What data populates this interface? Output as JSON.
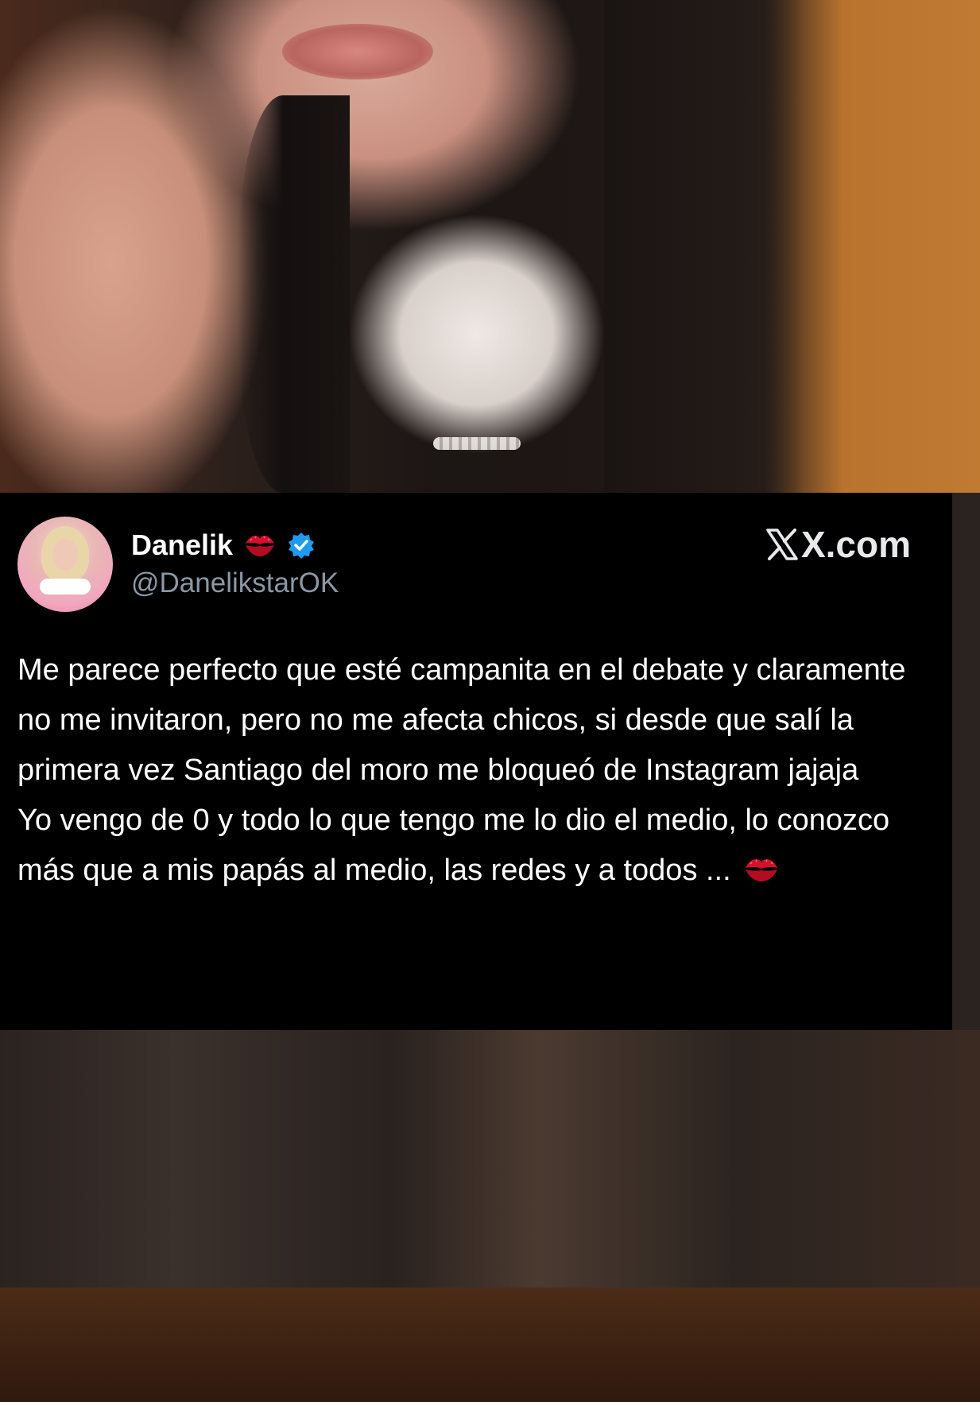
{
  "tweet": {
    "display_name": "Danelik",
    "handle": "@DanelikstarOK",
    "verified": true,
    "name_emoji": "kiss-mark-icon",
    "brand": "X.com",
    "paragraph_1": "Me parece perfecto que esté campanita en el debate y claramente no me invitaron, pero no me afecta chicos, si desde que salí la primera vez Santiago del moro me bloqueó de Instagram jajaja",
    "paragraph_2": "Yo vengo de 0 y todo lo que tengo me lo dio el medio, lo conozco más que a mis papás al medio, las redes y a todos ...",
    "trailing_emoji": "kiss-mark-icon"
  },
  "colors": {
    "card_background": "#000000",
    "text_primary": "#ffffff",
    "text_secondary": "#8b98a5",
    "verified_blue": "#1d9bf0",
    "kiss_red": "#d4102a"
  }
}
